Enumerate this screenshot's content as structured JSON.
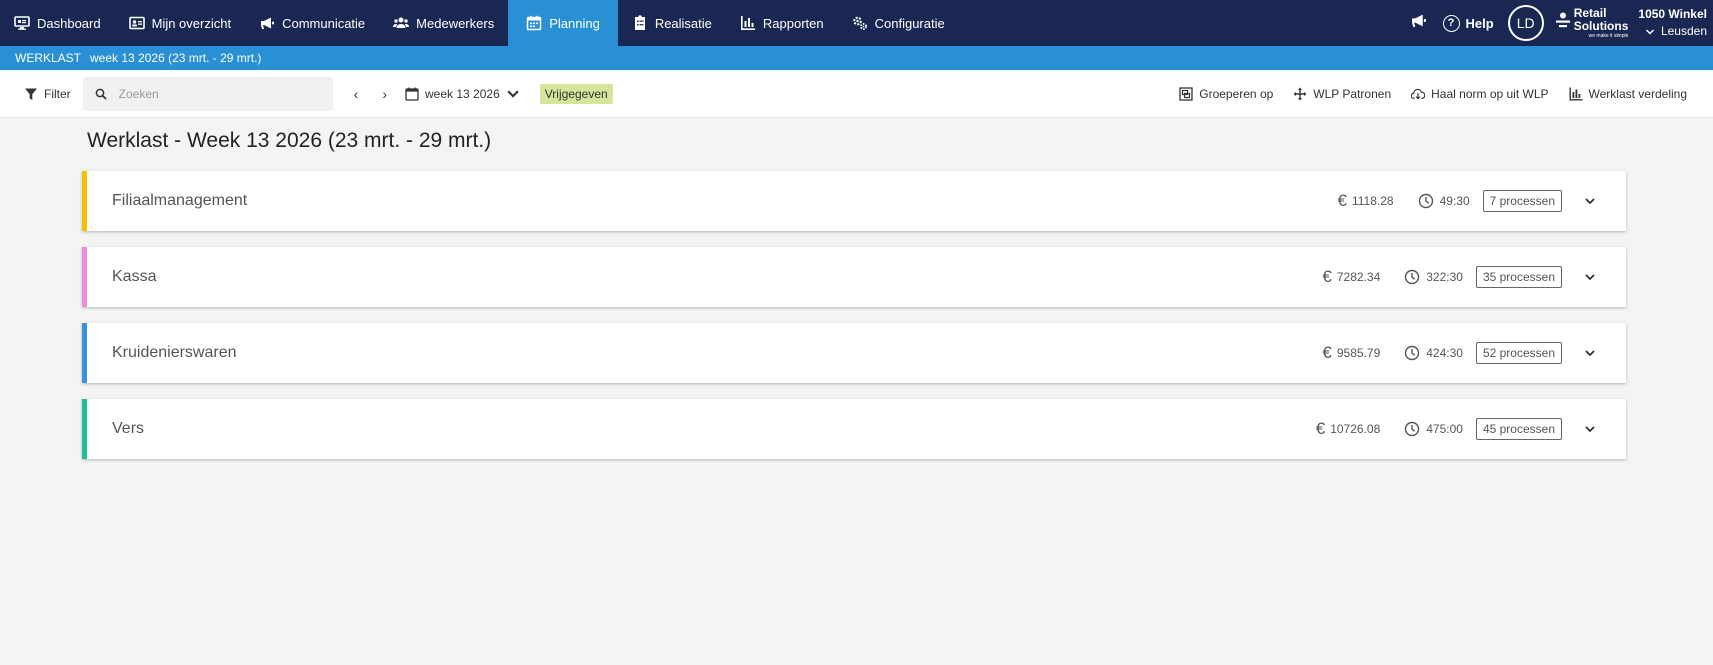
{
  "nav": {
    "items": [
      {
        "label": "Dashboard",
        "icon": "monitor-icon"
      },
      {
        "label": "Mijn overzicht",
        "icon": "id-card-icon"
      },
      {
        "label": "Communicatie",
        "icon": "megaphone-icon"
      },
      {
        "label": "Medewerkers",
        "icon": "users-icon"
      },
      {
        "label": "Planning",
        "icon": "calendar-icon"
      },
      {
        "label": "Realisatie",
        "icon": "clipboard-icon"
      },
      {
        "label": "Rapporten",
        "icon": "bar-chart-icon"
      },
      {
        "label": "Configuratie",
        "icon": "gears-icon"
      }
    ],
    "active": "Planning",
    "help_label": "Help",
    "avatar_initials": "LD",
    "logo_line1": "Retail",
    "logo_line2": "Solutions",
    "logo_tagline": "we make it simple",
    "store_name": "1050 Winkel",
    "store_location": "Leusden"
  },
  "subheader": {
    "label": "WERKLAST",
    "period": "week 13 2026 (23 mrt. - 29 mrt.)"
  },
  "toolbar": {
    "filter_label": "Filter",
    "search_placeholder": "Zoeken",
    "prev": "‹",
    "next": "›",
    "week_label": "week 13 2026",
    "status_badge": "Vrijgegeven",
    "group_label": "Groeperen op",
    "patterns_label": "WLP Patronen",
    "fetch_norm_label": "Haal norm op uit WLP",
    "distribution_label": "Werklast verdeling"
  },
  "main": {
    "title": "Werklast - Week 13 2026 (23 mrt. - 29 mrt.)",
    "groups": [
      {
        "name": "Filiaalmanagement",
        "cost": "1118.28",
        "time": "49:30",
        "processes": "7 processen",
        "color": "#f2c200"
      },
      {
        "name": "Kassa",
        "cost": "7282.34",
        "time": "322:30",
        "processes": "35 processen",
        "color": "#e88ee0"
      },
      {
        "name": "Kruidenierswaren",
        "cost": "9585.79",
        "time": "424:30",
        "processes": "52 processen",
        "color": "#3a94d6"
      },
      {
        "name": "Vers",
        "cost": "10726.08",
        "time": "475:00",
        "processes": "45 processen",
        "color": "#1fbf9c"
      }
    ]
  },
  "colors": {
    "nav_bg": "#1a2753",
    "accent": "#2a90d6",
    "badge_bg": "#d5e59b"
  }
}
